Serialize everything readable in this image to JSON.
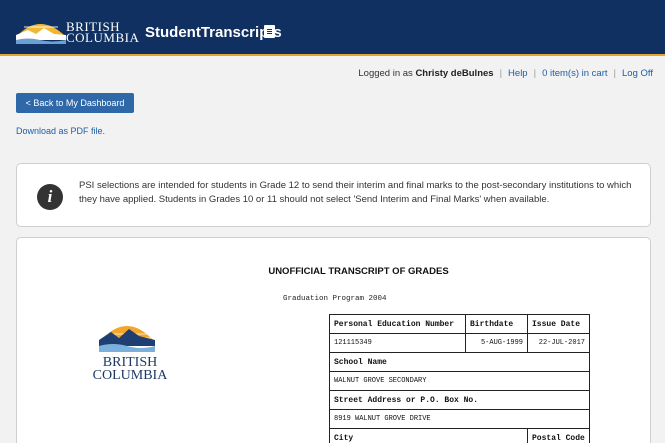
{
  "header": {
    "logo_line1": "BRITISH",
    "logo_line2": "COLUMBIA",
    "app_title": "StudentTranscripts"
  },
  "userbar": {
    "logged_in_prefix": "Logged in as",
    "user_name": "Christy deBulnes",
    "help": "Help",
    "cart": "0 item(s) in cart",
    "logoff": "Log Off"
  },
  "nav": {
    "back_button": "< Back to My Dashboard",
    "pdf_link": "Download as PDF file."
  },
  "info": {
    "message": "PSI selections are intended for students in Grade 12 to send their interim and final marks to the post-secondary institutions to which they have applied. Students in Grades 10 or 11 should not select 'Send Interim and Final Marks' when available."
  },
  "transcript": {
    "title": "UNOFFICIAL TRANSCRIPT OF GRADES",
    "program": "Graduation Program 2004",
    "logo_line1": "BRITISH",
    "logo_line2": "COLUMBIA",
    "pen_label": "Personal Education Number",
    "pen_value": "121115349",
    "birthdate_label": "Birthdate",
    "birthdate_value": "5-AUG-1999",
    "issue_label": "Issue Date",
    "issue_value": "22-JUL-2017",
    "school_label": "School Name",
    "school_value": "WALNUT GROVE SECONDARY",
    "address_label": "Street Address or P.O. Box No.",
    "address_value": "8919 WALNUT GROVE DRIVE",
    "city_label": "City",
    "postal_label": "Postal Code"
  },
  "colors": {
    "header_bg": "#0f3060",
    "header_accent": "#e3a82b",
    "button_bg": "#2e68a8",
    "link": "#1b5ea8"
  }
}
